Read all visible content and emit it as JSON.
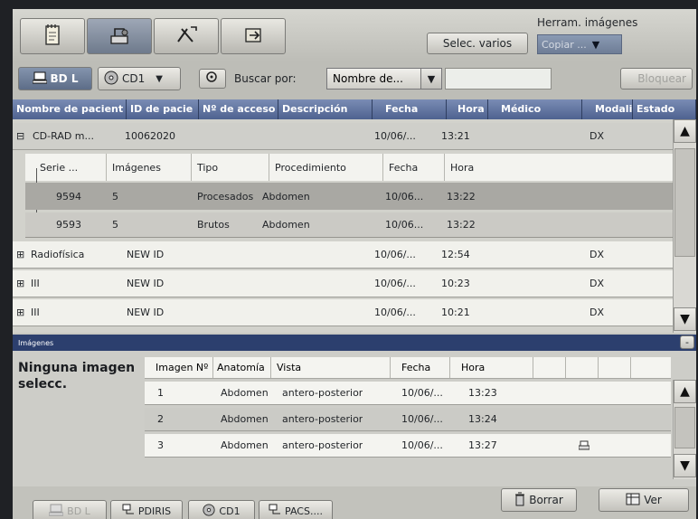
{
  "topbar": {
    "tabs": [
      {
        "name": "notebook",
        "icon": "notebook-icon",
        "active": false
      },
      {
        "name": "xray",
        "icon": "xray-device-icon",
        "active": true
      },
      {
        "name": "tools",
        "icon": "tools-icon",
        "active": false
      },
      {
        "name": "export",
        "icon": "export-icon",
        "active": false
      }
    ],
    "select_multiple": "Selec. varios",
    "image_tools_label": "Herram. imágenes",
    "copy_dropdown": "Copiar ..."
  },
  "toolbar": {
    "db_button": "BD L",
    "cd_dropdown": "CD1",
    "search_label": "Buscar por:",
    "search_field_dropdown": "Nombre de...",
    "search_input_value": "",
    "lock_button": "Bloquear"
  },
  "patients": {
    "columns": [
      "Nombre de pacient",
      "ID de pacie",
      "Nº de acceso",
      "Descripción",
      "Fecha",
      "Hora",
      "Médico",
      "Modali",
      "Estado"
    ],
    "rows": [
      {
        "expanded": true,
        "name": "CD-RAD m...",
        "id": "10062020",
        "fecha": "10/06/...",
        "hora": "13:21",
        "modalidad": "DX"
      },
      {
        "expanded": false,
        "name": "Radiofísica",
        "id": "NEW ID",
        "fecha": "10/06/...",
        "hora": "12:54",
        "modalidad": "DX"
      },
      {
        "expanded": false,
        "name": "III",
        "id": "NEW ID",
        "fecha": "10/06/...",
        "hora": "10:23",
        "modalidad": "DX"
      },
      {
        "expanded": false,
        "name": "III",
        "id": "NEW ID",
        "fecha": "10/06/...",
        "hora": "10:21",
        "modalidad": "DX"
      }
    ],
    "series_columns": [
      "Serie ...",
      "Imágenes",
      "Tipo",
      "Procedimiento",
      "Fecha",
      "Hora"
    ],
    "series": [
      {
        "serie": "9594",
        "imagenes": "5",
        "tipo": "Procesados",
        "procedimiento": "Abdomen",
        "fecha": "10/06...",
        "hora": "13:22"
      },
      {
        "serie": "9593",
        "imagenes": "5",
        "tipo": "Brutos",
        "procedimiento": "Abdomen",
        "fecha": "10/06...",
        "hora": "13:22"
      }
    ]
  },
  "images_panel": {
    "title": "Imágenes",
    "collapse_label": "-",
    "no_selection": "Ninguna imagen selecc.",
    "columns": [
      "Imagen Nº",
      "Anatomía",
      "Vista",
      "Fecha",
      "Hora"
    ],
    "rows": [
      {
        "num": "1",
        "anatomia": "Abdomen",
        "vista": "antero-posterior",
        "fecha": "10/06/...",
        "hora": "13:23",
        "icon": false
      },
      {
        "num": "2",
        "anatomia": "Abdomen",
        "vista": "antero-posterior",
        "fecha": "10/06/...",
        "hora": "13:24",
        "icon": false
      },
      {
        "num": "3",
        "anatomia": "Abdomen",
        "vista": "antero-posterior",
        "fecha": "10/06/...",
        "hora": "13:27",
        "icon": true
      }
    ]
  },
  "bottombar": {
    "db": "BD L",
    "pdiris": "PDIRIS",
    "cd1": "CD1",
    "pacs": "PACS....",
    "delete": "Borrar",
    "view": "Ver"
  }
}
